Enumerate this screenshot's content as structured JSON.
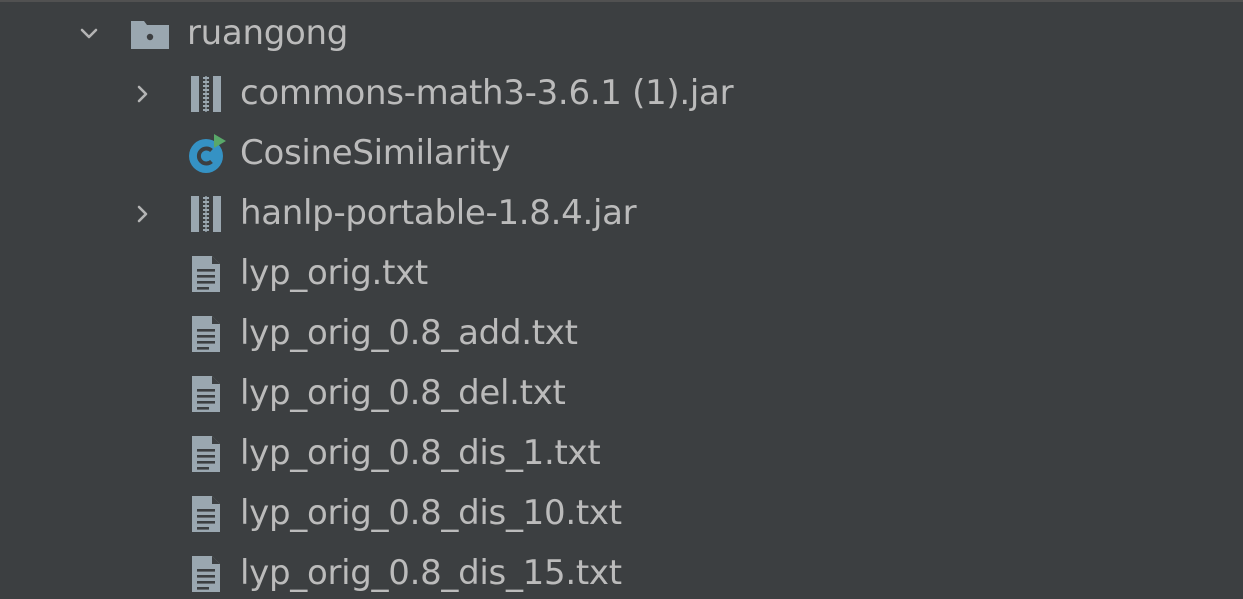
{
  "tree": {
    "root": {
      "label": "ruangong",
      "icon": "folder-icon",
      "expanded": true
    },
    "items": [
      {
        "label": "commons-math3-3.6.1 (1).jar",
        "icon": "jar-archive-icon",
        "expandable": true
      },
      {
        "label": "CosineSimilarity",
        "icon": "java-class-runnable-icon",
        "expandable": false
      },
      {
        "label": "hanlp-portable-1.8.4.jar",
        "icon": "jar-archive-icon",
        "expandable": true
      },
      {
        "label": "lyp_orig.txt",
        "icon": "text-file-icon",
        "expandable": false
      },
      {
        "label": "lyp_orig_0.8_add.txt",
        "icon": "text-file-icon",
        "expandable": false
      },
      {
        "label": "lyp_orig_0.8_del.txt",
        "icon": "text-file-icon",
        "expandable": false
      },
      {
        "label": "lyp_orig_0.8_dis_1.txt",
        "icon": "text-file-icon",
        "expandable": false
      },
      {
        "label": "lyp_orig_0.8_dis_10.txt",
        "icon": "text-file-icon",
        "expandable": false
      },
      {
        "label": "lyp_orig_0.8_dis_15.txt",
        "icon": "text-file-icon",
        "expandable": false
      }
    ]
  },
  "colors": {
    "background": "#3c3f41",
    "text": "#bbbbbb",
    "icon_gray": "#9aa7b0",
    "class_blue": "#3592c4",
    "run_green": "#59a869"
  }
}
